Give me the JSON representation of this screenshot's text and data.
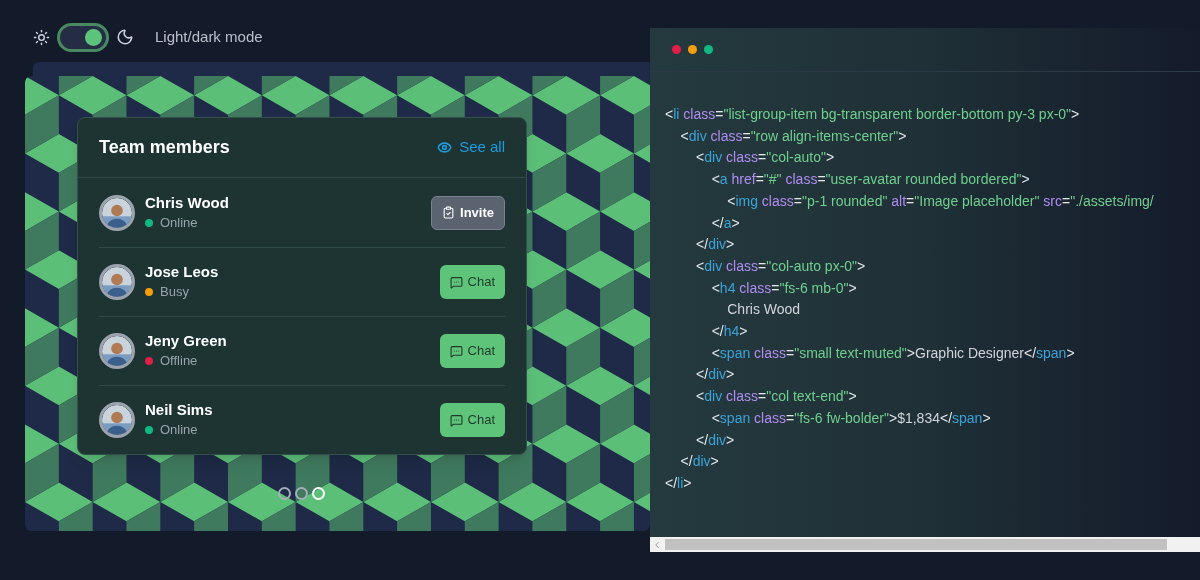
{
  "theme_toggle": {
    "label": "Light/dark mode",
    "on": true
  },
  "card": {
    "title": "Team members",
    "see_all": "See all",
    "members": [
      {
        "name": "Chris Wood",
        "status": "Online",
        "color": "#10b981",
        "action": {
          "kind": "invite",
          "label": "Invite"
        }
      },
      {
        "name": "Jose Leos",
        "status": "Busy",
        "color": "#f59e0b",
        "action": {
          "kind": "chat",
          "label": "Chat"
        }
      },
      {
        "name": "Jeny Green",
        "status": "Offline",
        "color": "#e11d48",
        "action": {
          "kind": "chat",
          "label": "Chat"
        }
      },
      {
        "name": "Neil Sims",
        "status": "Online",
        "color": "#10b981",
        "action": {
          "kind": "chat",
          "label": "Chat"
        }
      }
    ]
  },
  "carousel_dots": [
    {
      "selected": false
    },
    {
      "selected": false
    },
    {
      "selected": true
    }
  ],
  "code_window": {
    "lines": [
      {
        "tokens": [
          {
            "kind": "p",
            "text": "<"
          },
          {
            "kind": "tag",
            "text": "li"
          },
          {
            "kind": "attr",
            "text": " class"
          },
          {
            "kind": "p",
            "text": "="
          },
          {
            "kind": "str",
            "text": "\"list-group-item bg-transparent border-bottom py-3 px-0\""
          },
          {
            "kind": "p",
            "text": ">"
          }
        ]
      },
      {
        "tokens": [
          {
            "kind": "p",
            "text": "    <"
          },
          {
            "kind": "tag",
            "text": "div"
          },
          {
            "kind": "attr",
            "text": " class"
          },
          {
            "kind": "p",
            "text": "="
          },
          {
            "kind": "str",
            "text": "\"row align-items-center\""
          },
          {
            "kind": "p",
            "text": ">"
          }
        ]
      },
      {
        "tokens": [
          {
            "kind": "p",
            "text": "        <"
          },
          {
            "kind": "tag",
            "text": "div"
          },
          {
            "kind": "attr",
            "text": " class"
          },
          {
            "kind": "p",
            "text": "="
          },
          {
            "kind": "str",
            "text": "\"col-auto\""
          },
          {
            "kind": "p",
            "text": ">"
          }
        ]
      },
      {
        "tokens": [
          {
            "kind": "p",
            "text": "            <"
          },
          {
            "kind": "tag",
            "text": "a"
          },
          {
            "kind": "attr",
            "text": " href"
          },
          {
            "kind": "p",
            "text": "="
          },
          {
            "kind": "str",
            "text": "\"#\""
          },
          {
            "kind": "attr",
            "text": " class"
          },
          {
            "kind": "p",
            "text": "="
          },
          {
            "kind": "str",
            "text": "\"user-avatar rounded bordered\""
          },
          {
            "kind": "p",
            "text": ">"
          }
        ]
      },
      {
        "tokens": [
          {
            "kind": "p",
            "text": "                <"
          },
          {
            "kind": "tag",
            "text": "img"
          },
          {
            "kind": "attr",
            "text": " class"
          },
          {
            "kind": "p",
            "text": "="
          },
          {
            "kind": "str",
            "text": "\"p-1 rounded\""
          },
          {
            "kind": "attr",
            "text": " alt"
          },
          {
            "kind": "p",
            "text": "="
          },
          {
            "kind": "str",
            "text": "\"Image placeholder\""
          },
          {
            "kind": "attr",
            "text": " src"
          },
          {
            "kind": "p",
            "text": "="
          },
          {
            "kind": "str",
            "text": "\"./assets/img/"
          }
        ]
      },
      {
        "tokens": [
          {
            "kind": "p",
            "text": "            </"
          },
          {
            "kind": "tag",
            "text": "a"
          },
          {
            "kind": "p",
            "text": ">"
          }
        ]
      },
      {
        "tokens": [
          {
            "kind": "p",
            "text": "        </"
          },
          {
            "kind": "tag",
            "text": "div"
          },
          {
            "kind": "p",
            "text": ">"
          }
        ]
      },
      {
        "tokens": [
          {
            "kind": "p",
            "text": "        <"
          },
          {
            "kind": "tag",
            "text": "div"
          },
          {
            "kind": "attr",
            "text": " class"
          },
          {
            "kind": "p",
            "text": "="
          },
          {
            "kind": "str",
            "text": "\"col-auto px-0\""
          },
          {
            "kind": "p",
            "text": ">"
          }
        ]
      },
      {
        "tokens": [
          {
            "kind": "p",
            "text": "            <"
          },
          {
            "kind": "tag",
            "text": "h4"
          },
          {
            "kind": "attr",
            "text": " class"
          },
          {
            "kind": "p",
            "text": "="
          },
          {
            "kind": "str",
            "text": "\"fs-6 mb-0\""
          },
          {
            "kind": "p",
            "text": ">"
          }
        ]
      },
      {
        "tokens": [
          {
            "kind": "text",
            "text": "                Chris Wood"
          }
        ]
      },
      {
        "tokens": [
          {
            "kind": "p",
            "text": "            </"
          },
          {
            "kind": "tag",
            "text": "h4"
          },
          {
            "kind": "p",
            "text": ">"
          }
        ]
      },
      {
        "tokens": [
          {
            "kind": "p",
            "text": "            <"
          },
          {
            "kind": "tag",
            "text": "span"
          },
          {
            "kind": "attr",
            "text": " class"
          },
          {
            "kind": "p",
            "text": "="
          },
          {
            "kind": "str",
            "text": "\"small text-muted\""
          },
          {
            "kind": "p",
            "text": ">"
          },
          {
            "kind": "text",
            "text": "Graphic Designer"
          },
          {
            "kind": "p",
            "text": "</"
          },
          {
            "kind": "tag",
            "text": "span"
          },
          {
            "kind": "p",
            "text": ">"
          }
        ]
      },
      {
        "tokens": [
          {
            "kind": "p",
            "text": "        </"
          },
          {
            "kind": "tag",
            "text": "div"
          },
          {
            "kind": "p",
            "text": ">"
          }
        ]
      },
      {
        "tokens": [
          {
            "kind": "p",
            "text": "        <"
          },
          {
            "kind": "tag",
            "text": "div"
          },
          {
            "kind": "attr",
            "text": " class"
          },
          {
            "kind": "p",
            "text": "="
          },
          {
            "kind": "str",
            "text": "\"col text-end\""
          },
          {
            "kind": "p",
            "text": ">"
          }
        ]
      },
      {
        "tokens": [
          {
            "kind": "p",
            "text": "            <"
          },
          {
            "kind": "tag",
            "text": "span"
          },
          {
            "kind": "attr",
            "text": " class"
          },
          {
            "kind": "p",
            "text": "="
          },
          {
            "kind": "str",
            "text": "\"fs-6 fw-bolder\""
          },
          {
            "kind": "p",
            "text": ">"
          },
          {
            "kind": "text",
            "text": "$1,834"
          },
          {
            "kind": "p",
            "text": "</"
          },
          {
            "kind": "tag",
            "text": "span"
          },
          {
            "kind": "p",
            "text": ">"
          }
        ]
      },
      {
        "tokens": [
          {
            "kind": "p",
            "text": "        </"
          },
          {
            "kind": "tag",
            "text": "div"
          },
          {
            "kind": "p",
            "text": ">"
          }
        ]
      },
      {
        "tokens": [
          {
            "kind": "p",
            "text": "    </"
          },
          {
            "kind": "tag",
            "text": "div"
          },
          {
            "kind": "p",
            "text": ">"
          }
        ]
      },
      {
        "tokens": [
          {
            "kind": "p",
            "text": "</"
          },
          {
            "kind": "tag",
            "text": "li"
          },
          {
            "kind": "p",
            "text": ">"
          }
        ]
      }
    ]
  }
}
